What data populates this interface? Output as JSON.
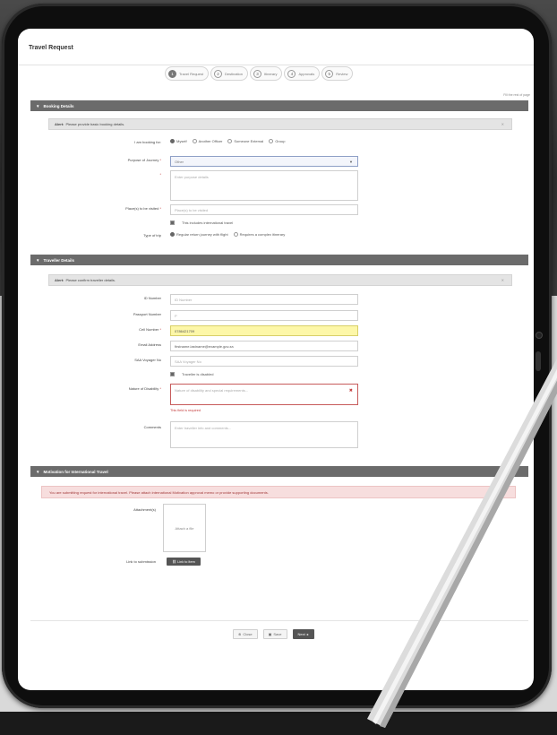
{
  "app": {
    "title": "Travel Request"
  },
  "stepper": [
    {
      "num": "1",
      "label": "Travel Request",
      "active": true
    },
    {
      "num": "2",
      "label": "Destination",
      "active": false
    },
    {
      "num": "3",
      "label": "Itinerary",
      "active": false
    },
    {
      "num": "4",
      "label": "Approvals",
      "active": false
    },
    {
      "num": "5",
      "label": "Review",
      "active": false
    }
  ],
  "small_link": "Fill the rest of page",
  "booking": {
    "header": "Booking Details",
    "info_label": "Alert:",
    "info_text": "Please provide basic booking details.",
    "booking_for_label": "I am booking for:",
    "booking_for_options": [
      "Myself",
      "Another Officer",
      "Someone External",
      "Group"
    ],
    "purpose_label": "Purpose of Journey",
    "purpose_value": "Other",
    "purpose_details_placeholder": "Enter purpose details",
    "places_label": "Place(s) to be visited",
    "places_placeholder": "Place(s) to be visited",
    "international_label": "This includes international travel",
    "trip_type_label": "Type of trip",
    "trip_type_options": [
      "Regular return journey with flight",
      "Requires a complex itinerary"
    ]
  },
  "traveller": {
    "header": "Traveller Details",
    "info_label": "Alert:",
    "info_text": "Please confirm traveller details.",
    "id_label": "ID Number",
    "id_placeholder": "ID Number",
    "passport_label": "Passport Number",
    "passport_placeholder": "P",
    "cell_label": "Cell Number",
    "cell_value": "0786421709",
    "email_label": "Email Address",
    "email_value": "firstname.lastname@example.gov.za",
    "voyager_label": "SAA Voyager No",
    "voyager_placeholder": "SAA Voyager No",
    "disabled_label": "Traveller is disabled",
    "disability_label": "Nature of Disability",
    "disability_placeholder": "Nature of disability and special requirements...",
    "disability_error": "This field is required",
    "comments_label": "Comments",
    "comments_placeholder": "Enter traveller info and comments..."
  },
  "international": {
    "header": "Motivation for International Travel",
    "alert_text": "You are submitting request for international travel. Please attach international Motivation approval memo or provide supporting documents.",
    "attachment_label": "Attachment(s)",
    "attachment_placeholder": "Attach a file",
    "submission_label": "Link to submission",
    "submission_button": "Link to Item"
  },
  "footer": {
    "close_label": "Close",
    "save_label": "Save",
    "next_label": "Next"
  }
}
